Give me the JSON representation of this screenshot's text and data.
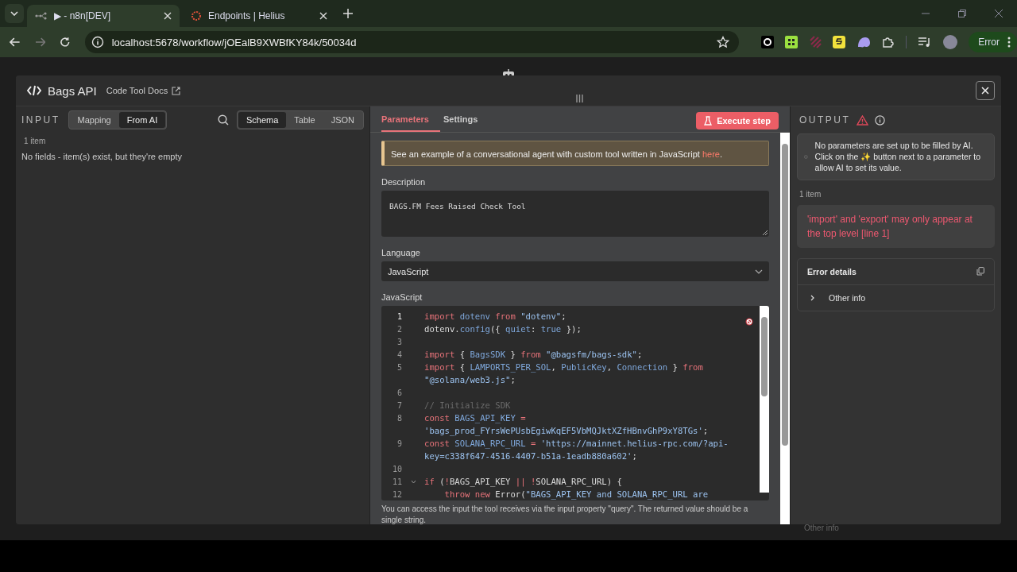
{
  "browser": {
    "tabs": [
      {
        "title": "▶ - n8n[DEV]",
        "selected": true
      },
      {
        "title": "Endpoints | Helius",
        "selected": false
      }
    ],
    "url": "localhost:5678/workflow/jOEalB9XWBfKY84k/50034d",
    "profile_status": "Error"
  },
  "node": {
    "title": "Bags API",
    "docs_link": "Code Tool Docs"
  },
  "input": {
    "heading": "INPUT",
    "modes": [
      {
        "label": "Mapping",
        "selected": false
      },
      {
        "label": "From AI",
        "selected": true
      }
    ],
    "views": [
      {
        "label": "Schema",
        "selected": true
      },
      {
        "label": "Table",
        "selected": false
      },
      {
        "label": "JSON",
        "selected": false
      }
    ],
    "count": "1 item",
    "message": "No fields - item(s) exist, but they're empty"
  },
  "parameters": {
    "tabs": [
      {
        "label": "Parameters",
        "selected": true
      },
      {
        "label": "Settings",
        "selected": false
      }
    ],
    "execute_button": "Execute step",
    "notice": {
      "text": "See an example of a conversational agent with custom tool written in JavaScript ",
      "link": "here",
      "end": "."
    },
    "description_label": "Description",
    "description": "BAGS.FM Fees Raised Check Tool",
    "language_label": "Language",
    "language": "JavaScript",
    "code_label": "JavaScript",
    "code": [
      {
        "number": "1",
        "active": true,
        "foldable": false,
        "segments": [
          [
            {
              "kind": "kw",
              "text": "import "
            },
            {
              "kind": "id",
              "text": "dotenv "
            },
            {
              "kind": "kw",
              "text": "from "
            },
            {
              "kind": "str",
              "text": "\"dotenv\""
            },
            {
              "kind": "pl",
              "text": ";"
            }
          ]
        ]
      },
      {
        "number": "2",
        "active": false,
        "foldable": false,
        "segments": [
          [
            {
              "kind": "pl",
              "text": "dotenv."
            },
            {
              "kind": "id",
              "text": "config"
            },
            {
              "kind": "pl",
              "text": "({ "
            },
            {
              "kind": "id",
              "text": "quiet"
            },
            {
              "kind": "pl",
              "text": ": "
            },
            {
              "kind": "id",
              "text": "true"
            },
            {
              "kind": "pl",
              "text": " });"
            }
          ]
        ]
      },
      {
        "number": "3",
        "active": false,
        "foldable": false
      },
      {
        "number": "4",
        "active": false,
        "foldable": false,
        "segments": [
          [
            {
              "kind": "kw",
              "text": "import "
            },
            {
              "kind": "pl",
              "text": "{ "
            },
            {
              "kind": "id",
              "text": "BagsSDK"
            },
            {
              "kind": "pl",
              "text": " } "
            },
            {
              "kind": "kw",
              "text": "from "
            },
            {
              "kind": "str",
              "text": "\"@bagsfm/bags-sdk\""
            },
            {
              "kind": "pl",
              "text": ";"
            }
          ]
        ]
      },
      {
        "number": "5",
        "active": false,
        "foldable": false,
        "segments": [
          [
            {
              "kind": "kw",
              "text": "import "
            },
            {
              "kind": "pl",
              "text": "{ "
            },
            {
              "kind": "id",
              "text": "LAMPORTS_PER_SOL"
            },
            {
              "kind": "pl",
              "text": ", "
            },
            {
              "kind": "id",
              "text": "PublicKey"
            },
            {
              "kind": "pl",
              "text": ", "
            },
            {
              "kind": "id",
              "text": "Connection"
            },
            {
              "kind": "pl",
              "text": " } "
            },
            {
              "kind": "kw",
              "text": "from"
            }
          ],
          [
            {
              "kind": "str",
              "text": "\"@solana/web3.js\""
            },
            {
              "kind": "pl",
              "text": ";"
            }
          ]
        ]
      },
      {
        "number": "6",
        "active": false,
        "foldable": false
      },
      {
        "number": "7",
        "active": false,
        "foldable": false,
        "segments": [
          [
            {
              "kind": "cm",
              "text": "// Initialize SDK"
            }
          ]
        ]
      },
      {
        "number": "8",
        "active": false,
        "foldable": false,
        "segments": [
          [
            {
              "kind": "kw",
              "text": "const "
            },
            {
              "kind": "id",
              "text": "BAGS_API_KEY"
            },
            {
              "kind": "op",
              "text": " ="
            }
          ],
          [
            {
              "kind": "str",
              "text": "'bags_prod_FYrsWePUsbEgiwKqEF5VbMQJktXZfHBnvGhP9xY8TGs'"
            },
            {
              "kind": "pl",
              "text": ";"
            }
          ]
        ]
      },
      {
        "number": "9",
        "active": false,
        "foldable": false,
        "segments": [
          [
            {
              "kind": "kw",
              "text": "const "
            },
            {
              "kind": "id",
              "text": "SOLANA_RPC_URL"
            },
            {
              "kind": "op",
              "text": " = "
            },
            {
              "kind": "str",
              "text": "'https://mainnet.helius-rpc.com/?api-"
            }
          ],
          [
            {
              "kind": "str",
              "text": "key=c338f647-4516-4407-b51a-1eadb880a602'"
            },
            {
              "kind": "pl",
              "text": ";"
            }
          ]
        ]
      },
      {
        "number": "10",
        "active": false,
        "foldable": false
      },
      {
        "number": "11",
        "active": false,
        "foldable": true,
        "segments": [
          [
            {
              "kind": "kw",
              "text": "if "
            },
            {
              "kind": "pl",
              "text": "("
            },
            {
              "kind": "op",
              "text": "!"
            },
            {
              "kind": "pl",
              "text": "BAGS_API_KEY "
            },
            {
              "kind": "op",
              "text": "|| !"
            },
            {
              "kind": "pl",
              "text": "SOLANA_RPC_URL) {"
            }
          ]
        ]
      },
      {
        "number": "12",
        "active": false,
        "foldable": false,
        "segments": [
          [
            {
              "kind": "kw",
              "text": "    throw new "
            },
            {
              "kind": "pl",
              "text": "Error("
            },
            {
              "kind": "str",
              "text": "\"BAGS_API_KEY and SOLANA_RPC_URL are"
            }
          ]
        ]
      }
    ],
    "hint": "You can access the input the tool receives via the input property \"query\". The returned value should be a single string."
  },
  "output": {
    "heading": "OUTPUT",
    "has_error": true,
    "ai_notice": "No parameters are set up to be filled by AI. Click on the ✨ button next to a parameter to allow AI to set its value.",
    "count": "1 item",
    "error": "'import' and 'export' may only appear at the top level [line 1]",
    "details_title": "Error details",
    "details_items": [
      {
        "label": "Other info",
        "expanded": false
      }
    ]
  },
  "background": {
    "text": "Other info"
  }
}
